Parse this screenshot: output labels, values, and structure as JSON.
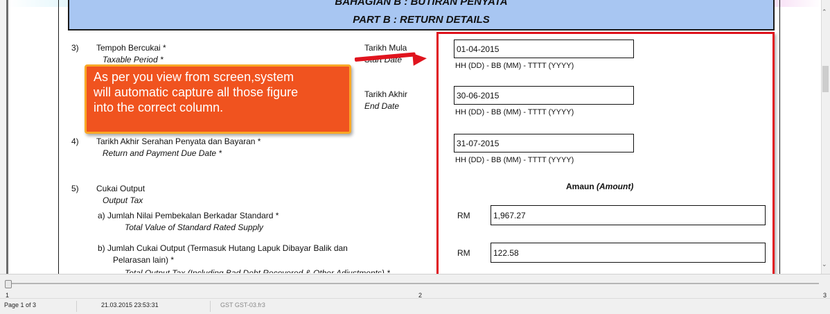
{
  "header": {
    "line1": "BAHAGIAN B : BUTIRAN PENYATA",
    "line2": "PART B : RETURN DETAILS"
  },
  "sections": {
    "s3": {
      "num": "3)",
      "label_ms": "Tempoh Bercukai *",
      "label_en": "Taxable Period *",
      "start_ms": "Tarikh Mula",
      "start_en": "Start Date",
      "end_ms": "Tarikh Akhir",
      "end_en": "End Date"
    },
    "s4": {
      "num": "4)",
      "label_ms": "Tarikh Akhir Serahan Penyata dan Bayaran *",
      "label_en": "Return and Payment Due Date *"
    },
    "s5": {
      "num": "5)",
      "label_ms": "Cukai Output",
      "label_en": "Output Tax",
      "a_label_ms": "a)   Jumlah Nilai Pembekalan Berkadar Standard *",
      "a_label_en": "Total Value of Standard Rated Supply",
      "b_label_ms": "b)   Jumlah Cukai Output (Termasuk Hutang Lapuk Dibayar Balik dan",
      "b_label_ms2": "Pelarasan lain) *",
      "b_label_en": "Total Output Tax (Including Bad Debt Recovered & Other Adjustments) *"
    }
  },
  "fields": {
    "start_date": "01-04-2015",
    "end_date": "30-06-2015",
    "due_date": "31-07-2015",
    "date_format": "HH (DD)  -  BB (MM)  -  TTTT (YYYY)",
    "amount_heading_ms": "Amaun",
    "amount_heading_en": "(Amount)",
    "currency": "RM",
    "standard_rated_supply": "1,967.27",
    "output_tax": "122.58"
  },
  "callout": {
    "text": "As per you view from screen,system\nwill automatic capture all those figure\ninto the correct column."
  },
  "page_slider": {
    "ticks": [
      "1",
      "2",
      "3"
    ]
  },
  "status": {
    "page": "Page 1 of 3",
    "timestamp": "21.03.2015 23:53:31",
    "report": "GST GST-03.fr3"
  },
  "colors": {
    "header_fill": "#a8c6f2",
    "highlight_red": "#e0141e",
    "callout_orange": "#f0531f",
    "callout_border": "#f9a826"
  }
}
